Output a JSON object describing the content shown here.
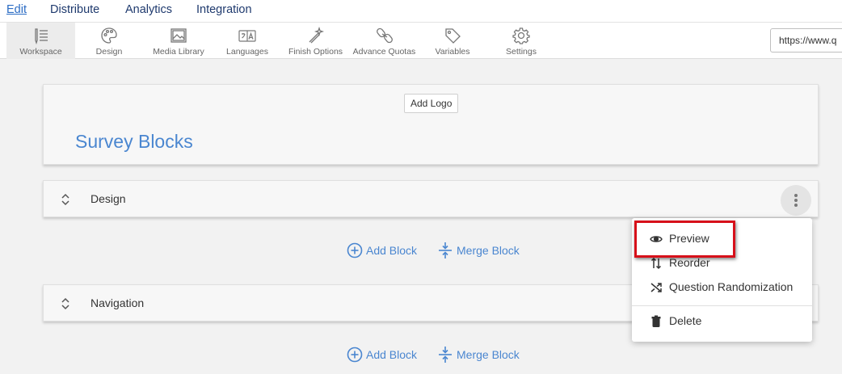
{
  "topnav": {
    "items": [
      {
        "label": "Edit",
        "active": true
      },
      {
        "label": "Distribute",
        "active": false
      },
      {
        "label": "Analytics",
        "active": false
      },
      {
        "label": "Integration",
        "active": false
      }
    ]
  },
  "toolbar": {
    "tools": [
      {
        "label": "Workspace",
        "icon": "list-icon",
        "active": true
      },
      {
        "label": "Design",
        "icon": "palette-icon"
      },
      {
        "label": "Media Library",
        "icon": "image-icon"
      },
      {
        "label": "Languages",
        "icon": "translate-icon"
      },
      {
        "label": "Finish Options",
        "icon": "magic-wand-icon"
      },
      {
        "label": "Advance Quotas",
        "icon": "link-icon"
      },
      {
        "label": "Variables",
        "icon": "tag-icon"
      },
      {
        "label": "Settings",
        "icon": "gear-icon"
      }
    ],
    "url": "https://www.q"
  },
  "header": {
    "add_logo": "Add Logo",
    "title": "Survey Blocks"
  },
  "blocks": [
    {
      "name": "Design"
    },
    {
      "name": "Navigation"
    }
  ],
  "actions": {
    "add_block": "Add Block",
    "merge_block": "Merge Block"
  },
  "context_menu": {
    "items": [
      {
        "label": "Preview",
        "icon": "eye-icon"
      },
      {
        "label": "Reorder",
        "icon": "reorder-icon"
      },
      {
        "label": "Question Randomization",
        "icon": "shuffle-icon"
      },
      {
        "label": "Delete",
        "icon": "trash-icon"
      }
    ]
  },
  "colors": {
    "accent": "#4a86d0",
    "nav_text": "#1f3a6e",
    "highlight": "#d7101a",
    "background": "#f2f2f2"
  }
}
